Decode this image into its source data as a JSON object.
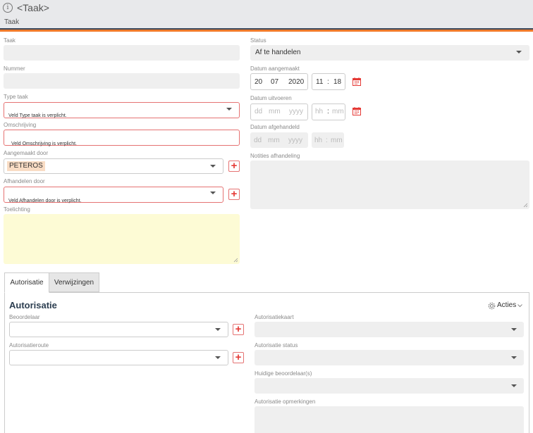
{
  "header": {
    "info_icon": "i",
    "title": "<Taak>",
    "subtitle": "Taak"
  },
  "left": {
    "taak_label": "Taak",
    "nummer_label": "Nummer",
    "type_taak_label": "Type taak",
    "type_taak_error": "Veld Type taak is verplicht.",
    "omschrijving_label": "Omschrijving",
    "omschrijving_error": "Veld Omschrijving is verplicht.",
    "aangemaakt_door_label": "Aangemaakt door",
    "aangemaakt_door_value": "PETEROS",
    "afhandelen_door_label": "Afhandelen door",
    "afhandelen_door_error": "Veld Afhandelen door is verplicht.",
    "toelichting_label": "Toelichting"
  },
  "right": {
    "status_label": "Status",
    "status_value": "Af te handelen",
    "datum_aangemaakt_label": "Datum aangemaakt",
    "datum_aangemaakt": {
      "dd": "20",
      "mm": "07",
      "yyyy": "2020",
      "hh": "11",
      "min": "18"
    },
    "datum_uitvoeren_label": "Datum uitvoeren",
    "datum_afgehandeld_label": "Datum afgehandeld",
    "ph": {
      "dd": "dd",
      "mm": "mm",
      "yyyy": "yyyy",
      "hh": "hh",
      "min": "mm",
      "sep": ":"
    },
    "notities_label": "Notities afhandeling"
  },
  "tabs": [
    {
      "label": "Autorisatie"
    },
    {
      "label": "Verwijzingen"
    }
  ],
  "autorisatie": {
    "title": "Autorisatie",
    "acties_label": "Acties",
    "beoordelaar_label": "Beoordelaar",
    "autorisatieroute_label": "Autorisatieroute",
    "autorisatiekaart_label": "Autorisatiekaart",
    "autorisatie_status_label": "Autorisatie status",
    "huidige_beoordelaars_label": "Huidige beoordelaar(s)",
    "opmerkingen_label": "Autorisatie opmerkingen"
  },
  "colors": {
    "accent": "#f07b2a",
    "error": "#e57373",
    "plus": "#e53935",
    "toelichting_bg": "#fdfbd5",
    "header_bg": "#e8e9eb",
    "tag_bg": "#f9dcc4"
  },
  "icons": [
    "info-icon",
    "calendar-icon",
    "plus-icon",
    "gear-icon",
    "chevron-down-icon",
    "resize-handle-icon"
  ]
}
